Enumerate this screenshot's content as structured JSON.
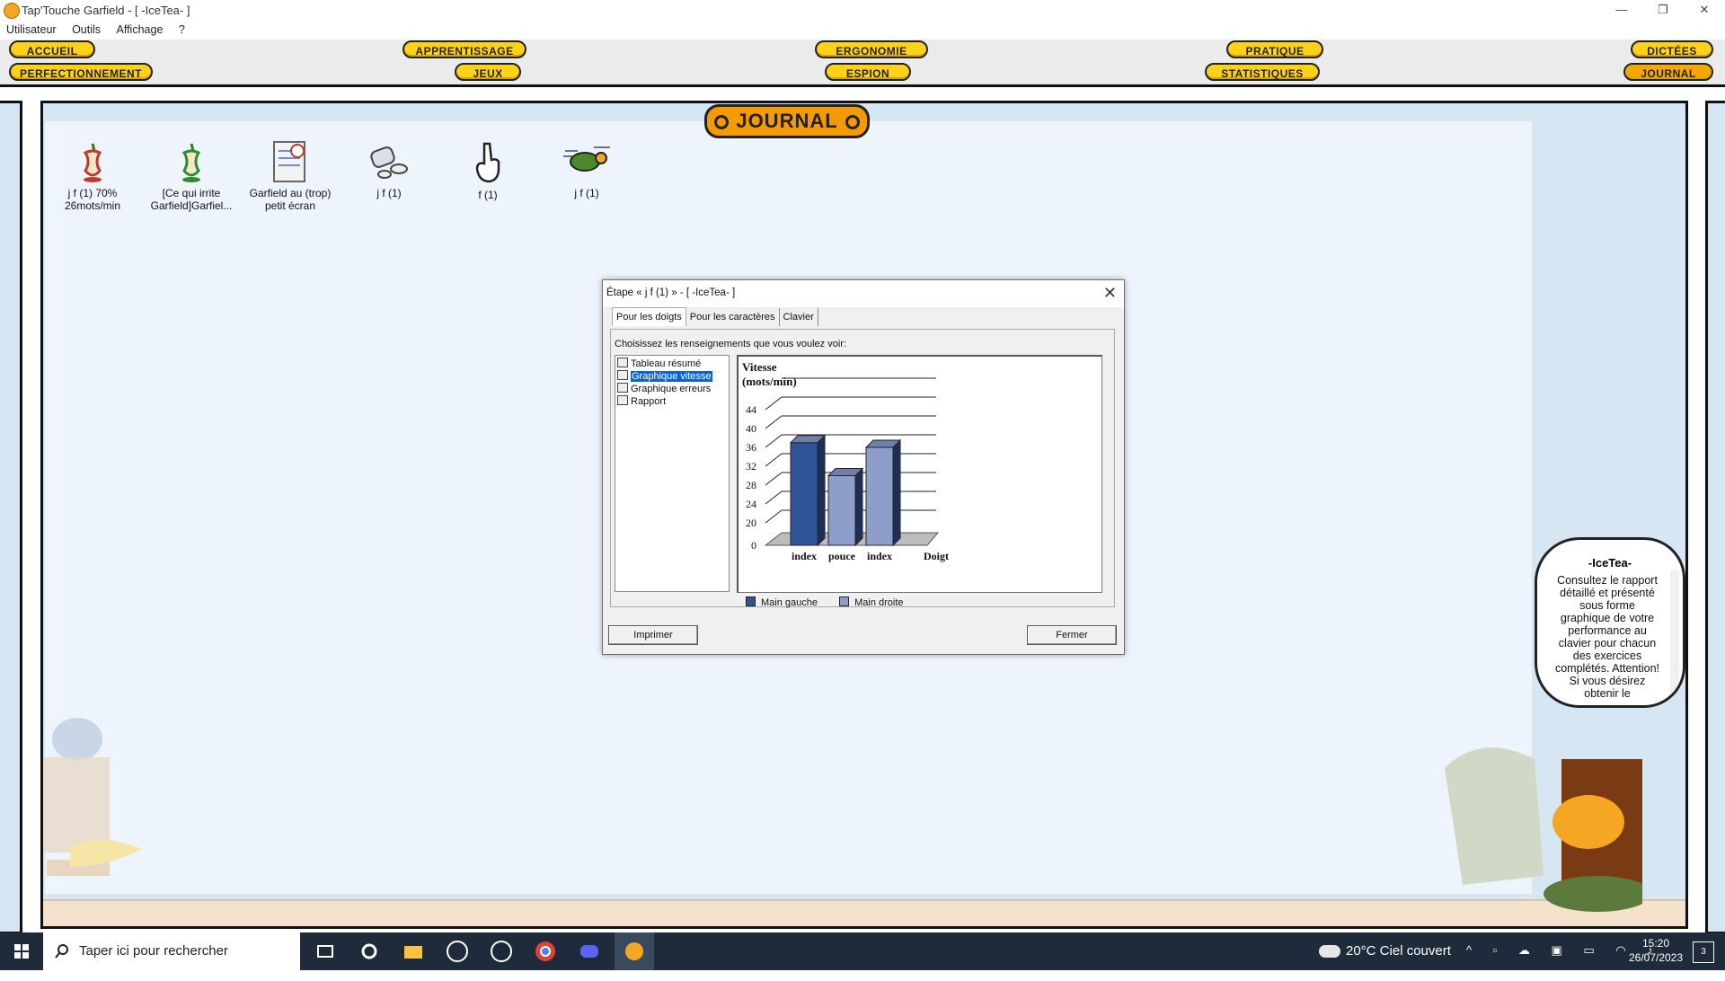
{
  "window": {
    "title": "Tap'Touche Garfield - [ -IceTea- ]",
    "controls": {
      "minimize": "—",
      "restore": "❐",
      "close": "✕"
    }
  },
  "menu": [
    "Utilisateur",
    "Outils",
    "Affichage",
    "?"
  ],
  "nav": {
    "row1": [
      "ACCUEIL",
      "APPRENTISSAGE",
      "ERGONOMIE",
      "PRATIQUE",
      "DICTÉES"
    ],
    "row2": [
      "PERFECTIONNEMENT",
      "JEUX",
      "ESPION",
      "STATISTIQUES",
      "JOURNAL"
    ],
    "active": "JOURNAL"
  },
  "journal": {
    "title": "JOURNAL",
    "icons": [
      {
        "label": "j f (1) 70% 26mots/min",
        "icon": "apple-core-icon"
      },
      {
        "label": "[Ce qui irrite Garfield]Garfiel...",
        "icon": "apple-core-icon"
      },
      {
        "label": "Garfield au (trop) petit écran",
        "icon": "certificate-icon"
      },
      {
        "label": "j f (1)",
        "icon": "pills-icon"
      },
      {
        "label": "f (1)",
        "icon": "hand-icon"
      },
      {
        "label": "j f (1)",
        "icon": "turtle-icon"
      }
    ]
  },
  "dialog": {
    "title": "Étape « j f (1) » - [ -IceTea- ]",
    "close": "✕",
    "tabs": [
      "Pour les doigts",
      "Pour les caractères",
      "Clavier"
    ],
    "choose_label": "Choisissez les renseignements que vous voulez voir:",
    "tree": [
      "Tableau résumé",
      "Graphique vitesse",
      "Graphique erreurs",
      "Rapport"
    ],
    "selected_tree": "Graphique vitesse",
    "print_button": "Imprimer",
    "close_button": "Fermer"
  },
  "chart_data": {
    "type": "bar",
    "title": "Vitesse\n(mots/min)",
    "ylabel": "Vitesse (mots/min)",
    "xlabel": "Doigt",
    "categories": [
      "index",
      "pouce",
      "index"
    ],
    "values": [
      37,
      30,
      36
    ],
    "series_of_bar": [
      "Main gauche",
      "Main droite",
      "Main droite"
    ],
    "legend": [
      {
        "name": "Main gauche",
        "color": "#2e5597"
      },
      {
        "name": "Main droite",
        "color": "#8c9ec9"
      }
    ],
    "yticks": [
      0,
      20,
      24,
      28,
      32,
      36,
      40,
      44
    ],
    "ylim": [
      0,
      44
    ],
    "grid": true,
    "legend_placement": "bottom"
  },
  "bubble": {
    "name": "-IceTea-",
    "message": "Consultez le rapport détaillé et présenté sous forme graphique de votre performance au clavier pour chacun des exercices complétés. Attention! Si vous désirez obtenir le"
  },
  "taskbar": {
    "search_placeholder": "Taper ici pour rechercher",
    "weather": "20°C  Ciel couvert",
    "time": "15:20",
    "date": "26/07/2023",
    "notifications": "3"
  },
  "colors": {
    "nav_button": "#ffd21a",
    "nav_active": "#f7a800",
    "content_bg": "#d7e6f3",
    "selection": "#0a64d8"
  }
}
